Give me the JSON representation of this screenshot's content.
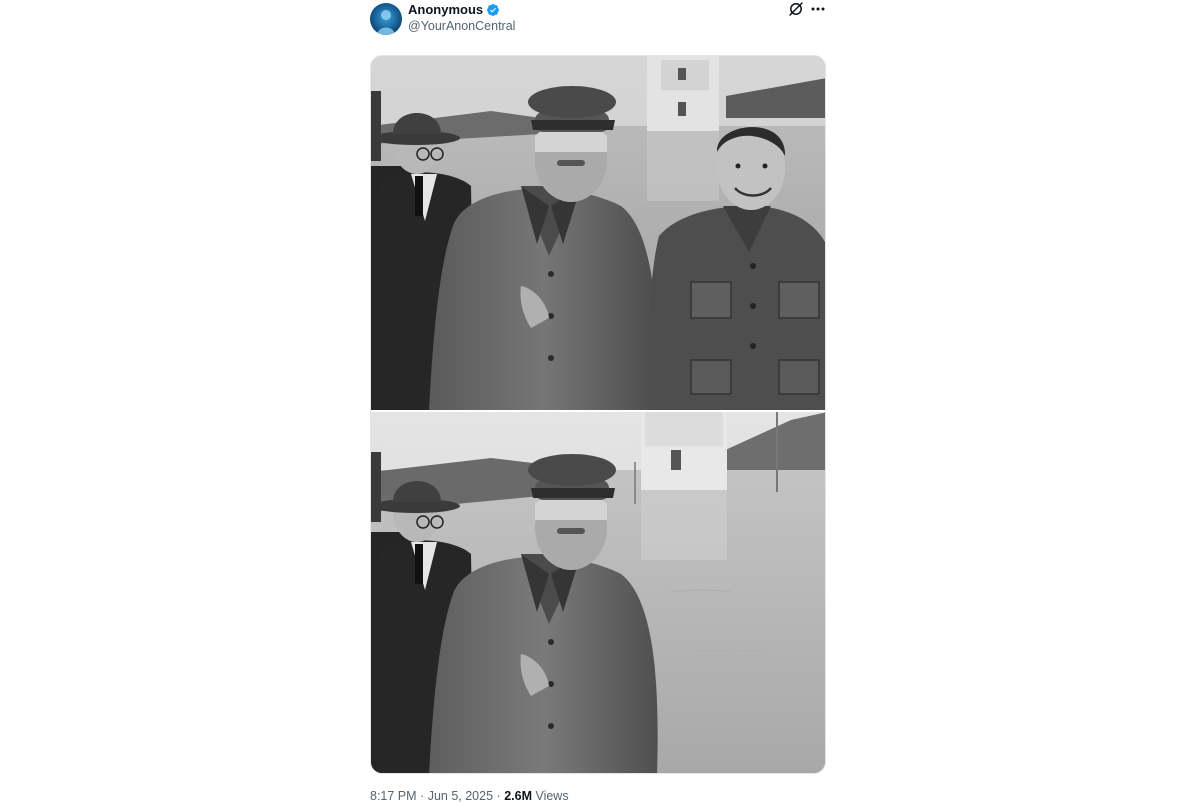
{
  "post": {
    "author": {
      "display_name": "Anonymous",
      "handle": "@YourAnonCentral",
      "verified": true,
      "verified_color": "#1d9bf0"
    },
    "header_icons": [
      "grok-icon",
      "more-icon"
    ],
    "media": {
      "count": 2,
      "photos": [
        {
          "description_icon": "photo",
          "style": "black-and-white"
        },
        {
          "description_icon": "photo",
          "style": "black-and-white"
        }
      ]
    },
    "meta": {
      "time": "8:17 PM",
      "separator": "·",
      "date": "Jun 5, 2025",
      "views_count": "2.6M",
      "views_label": "Views"
    }
  },
  "colors": {
    "text_primary": "#0f1419",
    "text_secondary": "#536471",
    "accent": "#1d9bf0"
  }
}
